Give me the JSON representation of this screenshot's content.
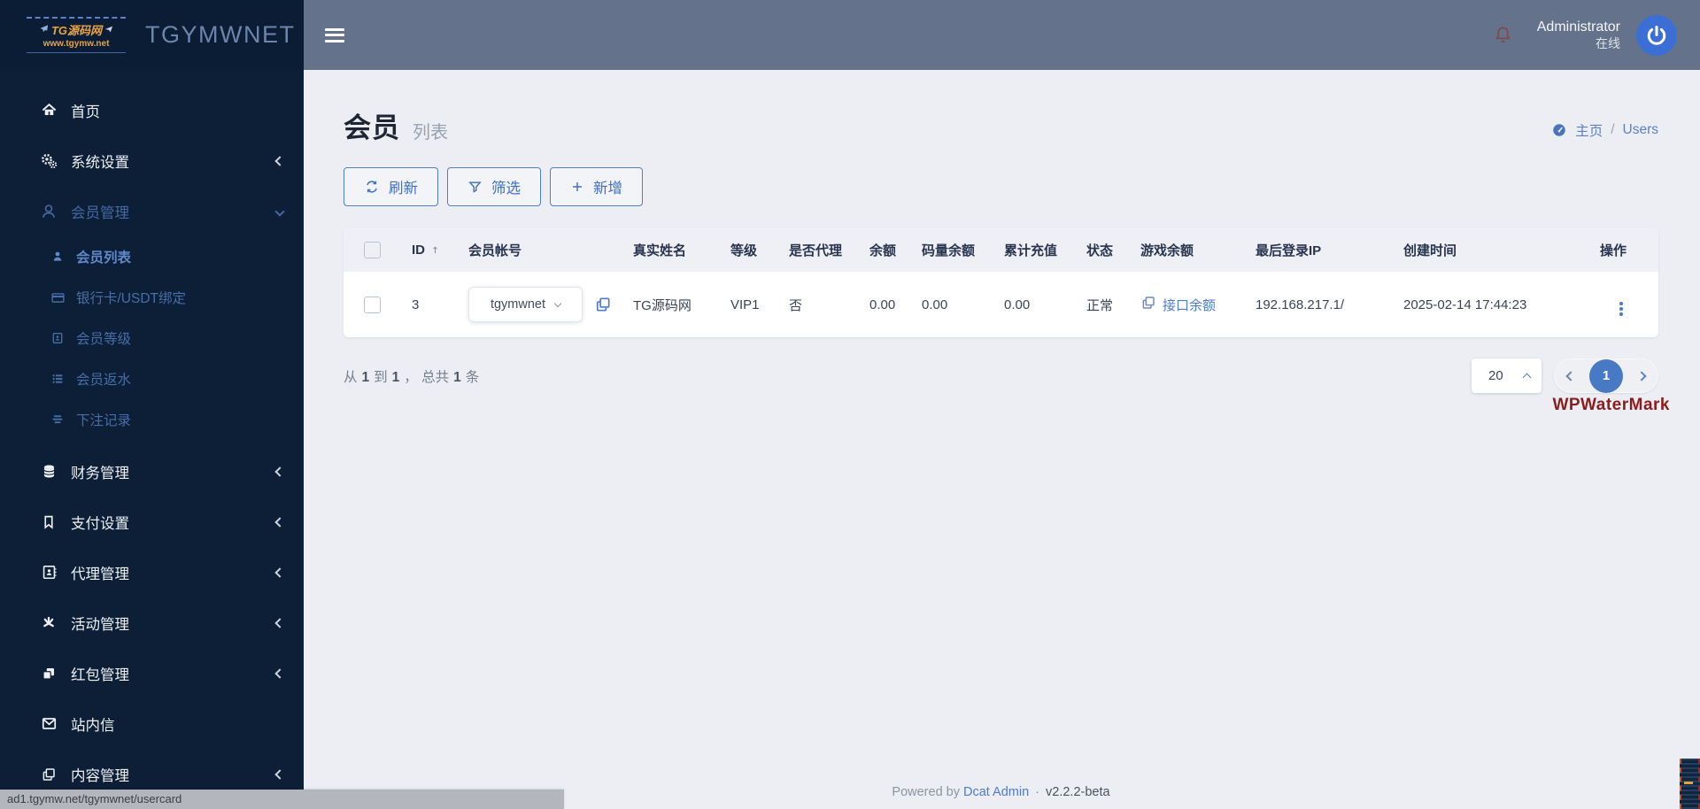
{
  "browser": {
    "status_url": "ad1.tgymw.net/tgymwnet/usercard"
  },
  "sidebar": {
    "logo": {
      "title": "TG源码网",
      "url": "www.tgymw.net",
      "brand": "TGYMWNET"
    },
    "items": [
      {
        "label": "首页",
        "icon": "home-icon",
        "variant": "parent",
        "chevron": "none",
        "state": "default"
      },
      {
        "label": "系统设置",
        "icon": "gears-icon",
        "variant": "parent",
        "chevron": "collapsed",
        "state": "default"
      },
      {
        "label": "会员管理",
        "icon": "user-icon",
        "variant": "parent",
        "chevron": "expanded",
        "state": "section-active"
      },
      {
        "label": "会员列表",
        "icon": "member-icon",
        "variant": "sub",
        "chevron": "none",
        "state": "active"
      },
      {
        "label": "银行卡/USDT绑定",
        "icon": "credit-card-icon",
        "variant": "sub",
        "chevron": "none",
        "state": "section-active"
      },
      {
        "label": "会员等级",
        "icon": "id-badge-icon",
        "variant": "sub",
        "chevron": "none",
        "state": "section-active"
      },
      {
        "label": "会员返水",
        "icon": "list-icon",
        "variant": "sub",
        "chevron": "none",
        "state": "section-active"
      },
      {
        "label": "下注记录",
        "icon": "bars-icon",
        "variant": "sub",
        "chevron": "none",
        "state": "section-active"
      },
      {
        "label": "财务管理",
        "icon": "database-icon",
        "variant": "parent",
        "chevron": "collapsed",
        "state": "default"
      },
      {
        "label": "支付设置",
        "icon": "bookmark-icon",
        "variant": "parent",
        "chevron": "collapsed",
        "state": "default"
      },
      {
        "label": "代理管理",
        "icon": "address-book-icon",
        "variant": "parent",
        "chevron": "collapsed",
        "state": "default"
      },
      {
        "label": "活动管理",
        "icon": "activity-icon",
        "variant": "parent",
        "chevron": "collapsed",
        "state": "default"
      },
      {
        "label": "红包管理",
        "icon": "red-packet-icon",
        "variant": "parent",
        "chevron": "collapsed",
        "state": "default"
      },
      {
        "label": "站内信",
        "icon": "envelope-icon",
        "variant": "parent",
        "chevron": "none",
        "state": "default"
      },
      {
        "label": "内容管理",
        "icon": "content-copy-icon",
        "variant": "parent",
        "chevron": "collapsed",
        "state": "default"
      }
    ]
  },
  "header": {
    "username": "Administrator",
    "status": "在线"
  },
  "breadcrumb": {
    "home": "主页",
    "separator": "/",
    "current": "Users"
  },
  "page": {
    "title": "会员",
    "subtitle": "列表"
  },
  "toolbar": {
    "refresh": "刷新",
    "filter": "筛选",
    "add": "新增"
  },
  "table": {
    "columns": [
      "ID",
      "会员帐号",
      "真实姓名",
      "等级",
      "是否代理",
      "余额",
      "码量余额",
      "累计充值",
      "状态",
      "游戏余额",
      "最后登录IP",
      "创建时间",
      "操作"
    ],
    "rows": [
      {
        "id": "3",
        "account": "tgymwnet",
        "real_name": "TG源码网",
        "level": "VIP1",
        "is_agent": "否",
        "balance": "0.00",
        "code_balance": "0.00",
        "total_recharge": "0.00",
        "status": "正常",
        "game_balance_link": "接口余额",
        "last_login_ip": "192.168.217.1/",
        "created_at": "2025-02-14 17:44:23"
      }
    ]
  },
  "pagination": {
    "summary": {
      "s1": "从",
      "n1": "1",
      "s2": "到",
      "n2": "1",
      "s3": "， 总共",
      "n3": "1",
      "s4": "条"
    },
    "page_size": "20",
    "current_page": "1"
  },
  "watermark": "WPWaterMark",
  "footer": {
    "powered_by": "Powered by",
    "brand": "Dcat Admin",
    "separator": "·",
    "version": "v2.2.2-beta"
  },
  "colors": {
    "accent_blue": "#4c7bd1",
    "active_page": "#4879c5",
    "watermark_red": "#8b1d1d",
    "sidebar_bg": "#0c1f37",
    "header_bg": "#64738b"
  }
}
